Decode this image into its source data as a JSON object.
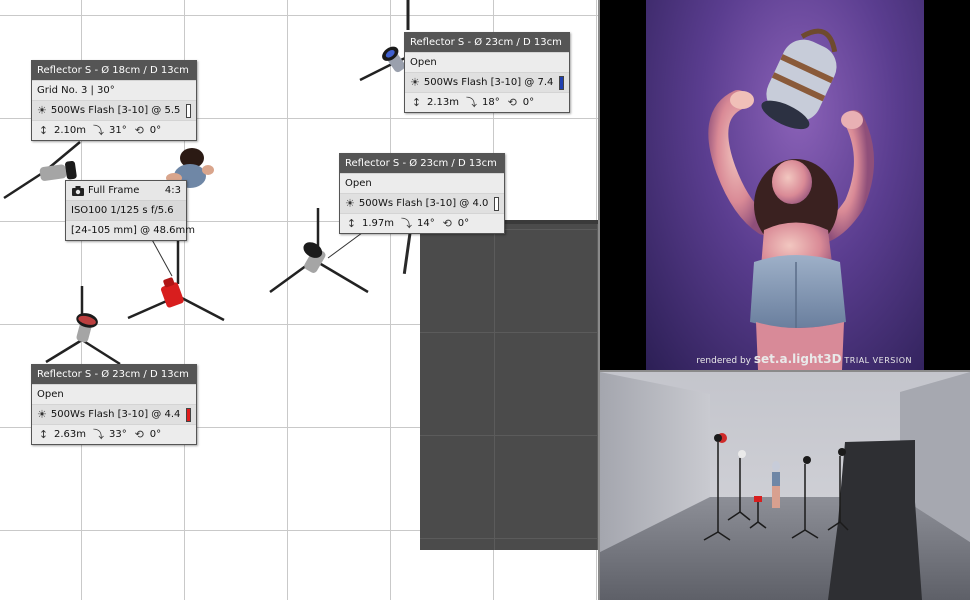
{
  "colors": {
    "box_header": "#555555",
    "box_body": "#ececec",
    "plan_grid": "#c9c9c9",
    "backdrop": "#4b4b4b",
    "light_red": "#d81e1e",
    "swatch_white": "#ffffff",
    "swatch_blue": "#1f3fb0",
    "swatch_red": "#e01b1b"
  },
  "lights": [
    {
      "title": "Reflector S - Ø 18cm / D 13cm",
      "modifier": "Grid No. 3 | 30°",
      "flash": "500Ws Flash [3-10] @ 5.5",
      "swatch": "white",
      "height": "2.10m",
      "tilt": "31°",
      "rotation": "0°"
    },
    {
      "title": "Reflector S - Ø 23cm / D 13cm",
      "modifier": "Open",
      "flash": "500Ws Flash [3-10] @ 7.4",
      "swatch": "blue",
      "height": "2.13m",
      "tilt": "18°",
      "rotation": "0°"
    },
    {
      "title": "Reflector S - Ø 23cm / D 13cm",
      "modifier": "Open",
      "flash": "500Ws Flash [3-10] @ 4.0",
      "swatch": "white",
      "height": "1.97m",
      "tilt": "14°",
      "rotation": "0°"
    },
    {
      "title": "Reflector S - Ø 23cm / D 13cm",
      "modifier": "Open",
      "flash": "500Ws Flash [3-10] @ 4.4",
      "swatch": "red",
      "height": "2.63m",
      "tilt": "33°",
      "rotation": "0°"
    }
  ],
  "camera": {
    "sensor": "Full Frame",
    "aspect": "4:3",
    "exposure": "ISO100 1/125 s f/5.6",
    "lens": "[24-105 mm] @ 48.6mm"
  },
  "render": {
    "watermark_prefix": "rendered by",
    "watermark_brand": "set.a.light3D",
    "watermark_suffix": "TRIAL VERSION"
  },
  "icons": {
    "flash": "sun-icon",
    "height": "height-arrows-icon",
    "tilt": "tilt-icon",
    "rotation": "rotation-icon",
    "camera": "camera-icon"
  }
}
